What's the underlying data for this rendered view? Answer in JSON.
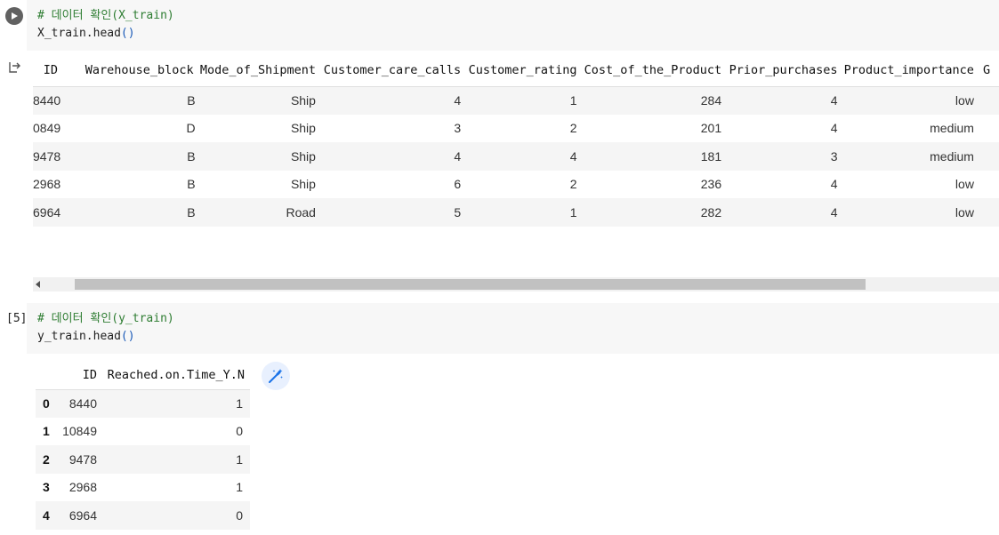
{
  "cell1": {
    "comment": "# 데이터 확인(X_train)",
    "code_name": "X_train.head",
    "code_parens": "()"
  },
  "df1": {
    "columns": [
      "ID",
      "Warehouse_block",
      "Mode_of_Shipment",
      "Customer_care_calls",
      "Customer_rating",
      "Cost_of_the_Product",
      "Prior_purchases",
      "Product_importance",
      "G"
    ],
    "rows": [
      [
        "8440",
        "B",
        "Ship",
        "4",
        "1",
        "284",
        "4",
        "low"
      ],
      [
        "0849",
        "D",
        "Ship",
        "3",
        "2",
        "201",
        "4",
        "medium"
      ],
      [
        "9478",
        "B",
        "Ship",
        "4",
        "4",
        "181",
        "3",
        "medium"
      ],
      [
        "2968",
        "B",
        "Ship",
        "6",
        "2",
        "236",
        "4",
        "low"
      ],
      [
        "6964",
        "B",
        "Road",
        "5",
        "1",
        "282",
        "4",
        "low"
      ]
    ]
  },
  "cell2": {
    "exec_count": "[5]",
    "comment": "# 데이터 확인(y_train)",
    "code_name": "y_train.head",
    "code_parens": "()"
  },
  "df2": {
    "columns": [
      "",
      "ID",
      "Reached.on.Time_Y.N"
    ],
    "rows": [
      [
        "0",
        "8440",
        "1"
      ],
      [
        "1",
        "10849",
        "0"
      ],
      [
        "2",
        "9478",
        "1"
      ],
      [
        "3",
        "2968",
        "1"
      ],
      [
        "4",
        "6964",
        "0"
      ]
    ]
  },
  "icons": {
    "run": "play-icon",
    "output": "output-arrow-icon",
    "suggest": "magic-wand-icon",
    "scroll": "scroll-left-arrow-icon"
  },
  "colors": {
    "comment": "#2e7d32",
    "paren": "#1a5ab8",
    "cell_bg": "#f7f7f7",
    "stripe": "#f5f5f5",
    "wand": "#1a73e8"
  }
}
